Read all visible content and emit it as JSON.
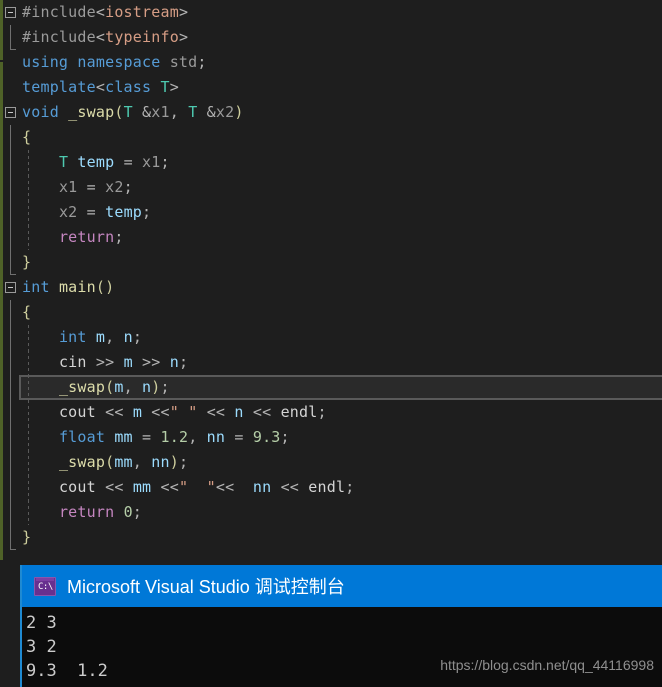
{
  "editor": {
    "name": "visual-studio-code-editor",
    "theme": "dark",
    "current_line_index": 13,
    "colors": {
      "background": "#1e1e1e",
      "keyword": "#569cd6",
      "type": "#4ec9b0",
      "function": "#dcdcaa",
      "variable": "#9cdcfe",
      "identifier": "#9a9a9a",
      "control": "#c586c0",
      "number": "#b5cea8",
      "string": "#d69d85",
      "preprocessor": "#9b9b9b",
      "change_marker": "#4f6228",
      "current_line_bg": "#2a2a2a"
    },
    "lines": [
      {
        "i": 0,
        "fold": "open",
        "guide": false,
        "plain": "#include<iostream>"
      },
      {
        "i": 1,
        "fold": "end",
        "guide": false,
        "plain": "#include<typeinfo>"
      },
      {
        "i": 2,
        "fold": "none",
        "guide": false,
        "plain": "using namespace std;"
      },
      {
        "i": 3,
        "fold": "none",
        "guide": false,
        "plain": "template<class T>"
      },
      {
        "i": 4,
        "fold": "open",
        "guide": false,
        "plain": "void _swap(T &x1, T &x2)"
      },
      {
        "i": 5,
        "fold": "bar",
        "guide": false,
        "plain": "{"
      },
      {
        "i": 6,
        "fold": "bar",
        "guide": true,
        "plain": "    T temp = x1;"
      },
      {
        "i": 7,
        "fold": "bar",
        "guide": true,
        "plain": "    x1 = x2;"
      },
      {
        "i": 8,
        "fold": "bar",
        "guide": true,
        "plain": "    x2 = temp;"
      },
      {
        "i": 9,
        "fold": "bar",
        "guide": true,
        "plain": "    return;"
      },
      {
        "i": 10,
        "fold": "end",
        "guide": false,
        "plain": "}"
      },
      {
        "i": 11,
        "fold": "open",
        "guide": false,
        "plain": "int main()"
      },
      {
        "i": 12,
        "fold": "bar",
        "guide": false,
        "plain": "{"
      },
      {
        "i": 13,
        "fold": "bar",
        "guide": true,
        "plain": "    int m, n;"
      },
      {
        "i": 14,
        "fold": "bar",
        "guide": true,
        "plain": "    cin >> m >> n;"
      },
      {
        "i": 15,
        "fold": "bar",
        "guide": true,
        "plain": "    _swap(m, n);"
      },
      {
        "i": 16,
        "fold": "bar",
        "guide": true,
        "plain": "    cout << m <<\" \" << n << endl;"
      },
      {
        "i": 17,
        "fold": "bar",
        "guide": true,
        "plain": "    float mm = 1.2, nn = 9.3;"
      },
      {
        "i": 18,
        "fold": "bar",
        "guide": true,
        "plain": "    _swap(mm, nn);"
      },
      {
        "i": 19,
        "fold": "bar",
        "guide": true,
        "plain": "    cout << mm <<\"  \"<<  nn << endl;"
      },
      {
        "i": 20,
        "fold": "bar",
        "guide": true,
        "plain": "    return 0;"
      },
      {
        "i": 21,
        "fold": "end",
        "guide": false,
        "plain": "}"
      }
    ]
  },
  "console": {
    "title": "Microsoft Visual Studio 调试控制台",
    "icon_prompt": "C:\\",
    "titlebar_color": "#0078d7",
    "background": "#0c0c0c",
    "output_lines": [
      "2 3",
      "3 2",
      "9.3  1.2"
    ]
  },
  "watermark": {
    "text": "https://blog.csdn.net/qq_44116998"
  }
}
